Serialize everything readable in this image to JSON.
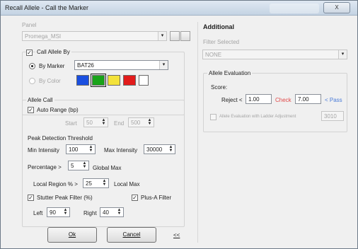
{
  "window": {
    "title": "Recall Allele - Call the Marker",
    "close_label": "X"
  },
  "left": {
    "panel_label": "Panel",
    "panel_value": "Promega_MSI",
    "call_allele_by_label": "Call Allele By",
    "call_allele_by_checked": true,
    "by_marker_label": "By Marker",
    "by_marker_value": "BAT26",
    "by_color_label": "By Color",
    "colors": [
      "#1a4fe0",
      "#19a319",
      "#f3e23a",
      "#e21b1b",
      "#ffffff"
    ],
    "allele_call_label": "Allele Call",
    "auto_range_label": "Auto Range (bp)",
    "auto_range_checked": true,
    "start_label": "Start",
    "start_value": "50",
    "end_label": "End",
    "end_value": "500",
    "peak_detection_label": "Peak Detection Threshold",
    "min_intensity_label": "Min Intensity",
    "min_intensity_value": "100",
    "max_intensity_label": "Max Intensity",
    "max_intensity_value": "30000",
    "percentage_label": "Percentage >",
    "percentage_value": "5",
    "global_max_label": "Global Max",
    "local_region_label": "Local Region % >",
    "local_region_value": "25",
    "local_max_label": "Local Max",
    "stutter_label": "Stutter Peak Filter (%)",
    "stutter_checked": true,
    "plus_a_label": "Plus-A Filter",
    "plus_a_checked": true,
    "left_label": "Left",
    "left_value": "90",
    "right_label": "Right",
    "right_value": "40"
  },
  "buttons": {
    "ok": "Ok",
    "cancel": "Cancel",
    "collapse": "<<"
  },
  "right": {
    "additional_label": "Additional",
    "filter_label": "Filter Selected",
    "filter_value": "NONE",
    "allele_eval_label": "Allele Evaluation",
    "score_label": "Score:",
    "reject_label": "Reject <",
    "reject_value": "1.00",
    "check_label": "Check",
    "check_value": "7.00",
    "pass_label": "< Pass",
    "adjust_label": "Allele Evaluation with Ladder Adjustment",
    "adjust_value": "3010"
  }
}
